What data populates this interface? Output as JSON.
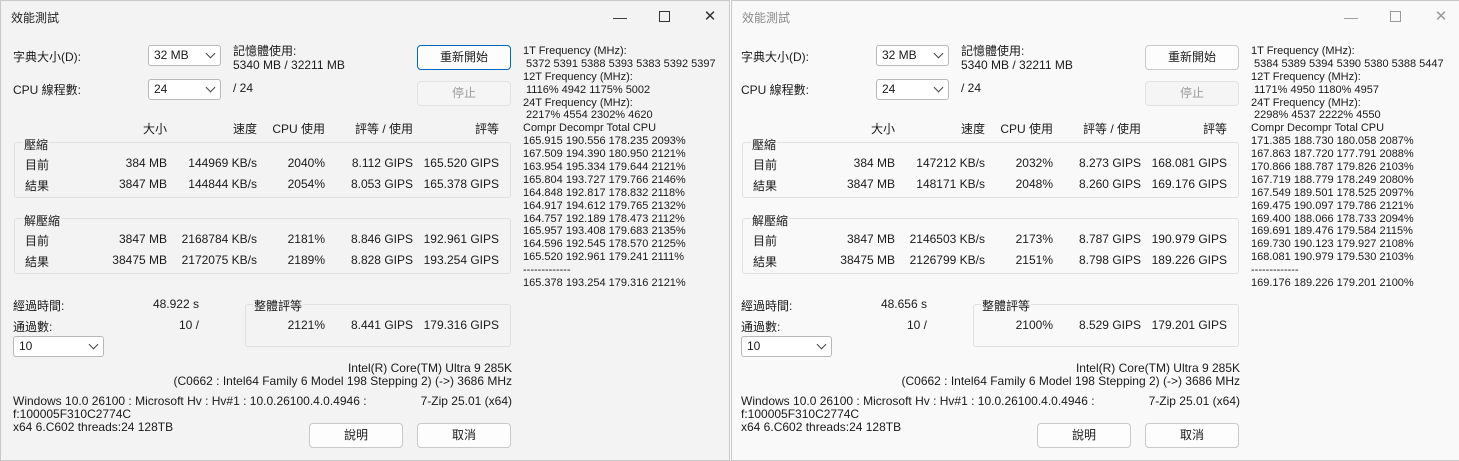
{
  "labels": {
    "dict_size": "字典大小(D):",
    "threads": "CPU 線程數:",
    "mem_usage": "記憶體使用:",
    "restart": "重新開始",
    "stop": "停止",
    "threads_total": "/ 24",
    "col_size": "大小",
    "col_speed": "速度",
    "col_cpu": "CPU 使用",
    "col_rating_usage": "評等 / 使用",
    "col_rating": "評等",
    "compress": "壓縮",
    "decompress": "解壓縮",
    "current": "目前",
    "result": "結果",
    "elapsed": "經過時間:",
    "passes": "通過數:",
    "passes_sep": "10 /",
    "total_rating": "整體評等",
    "help": "說明",
    "cancel": "取消"
  },
  "windows": [
    {
      "title": "效能測試",
      "dict_size": "32 MB",
      "threads": "24",
      "mem_usage": "5340 MB / 32211 MB",
      "compress": {
        "current": {
          "size": "384 MB",
          "speed": "144969 KB/s",
          "cpu": "2040%",
          "rating_usage": "8.112 GIPS",
          "rating": "165.520 GIPS"
        },
        "result": {
          "size": "3847 MB",
          "speed": "144844 KB/s",
          "cpu": "2054%",
          "rating_usage": "8.053 GIPS",
          "rating": "165.378 GIPS"
        }
      },
      "decompress": {
        "current": {
          "size": "3847 MB",
          "speed": "2168784 KB/s",
          "cpu": "2181%",
          "rating_usage": "8.846 GIPS",
          "rating": "192.961 GIPS"
        },
        "result": {
          "size": "38475 MB",
          "speed": "2172075 KB/s",
          "cpu": "2189%",
          "rating_usage": "8.828 GIPS",
          "rating": "193.254 GIPS"
        }
      },
      "elapsed": "48.922 s",
      "passes_select": "10",
      "total": {
        "cpu": "2121%",
        "rating_usage": "8.441 GIPS",
        "rating": "179.316 GIPS"
      },
      "cpu_name": "Intel(R) Core(TM) Ultra 9 285K",
      "cpu_detail": "(C0662 : Intel64 Family 6 Model 198 Stepping 2) (->) 3686 MHz",
      "os_line1": "Windows 10.0 26100 : Microsoft Hv : Hv#1 : 10.0.26100.4.0.4946 :",
      "os_line2": "f:100005F310C2774C",
      "os_line3": "x64 6.C602 threads:24 128TB",
      "version": "7-Zip 25.01 (x64)",
      "freq": [
        "1T Frequency (MHz):",
        " 5372 5391 5388 5393 5383 5392 5397",
        "12T Frequency (MHz):",
        " 1116% 4942 1175% 5002",
        "24T Frequency (MHz):",
        " 2217% 4554 2302% 4620",
        "Compr Decompr Total   CPU",
        "165.915  190.556  178.235  2093%",
        "167.509  194.390  180.950  2121%",
        "163.954  195.334  179.644  2121%",
        "165.804  193.727  179.766  2146%",
        "164.848  192.817  178.832  2118%",
        "164.917  194.612  179.765  2132%",
        "164.757  192.189  178.473  2112%",
        "165.957  193.408  179.683  2135%",
        "164.596  192.545  178.570  2125%",
        "165.520  192.961  179.241  2111%",
        "-------------",
        "165.378  193.254  179.316  2121%"
      ]
    },
    {
      "title": "效能測試",
      "dict_size": "32 MB",
      "threads": "24",
      "mem_usage": "5340 MB / 32211 MB",
      "compress": {
        "current": {
          "size": "384 MB",
          "speed": "147212 KB/s",
          "cpu": "2032%",
          "rating_usage": "8.273 GIPS",
          "rating": "168.081 GIPS"
        },
        "result": {
          "size": "3847 MB",
          "speed": "148171 KB/s",
          "cpu": "2048%",
          "rating_usage": "8.260 GIPS",
          "rating": "169.176 GIPS"
        }
      },
      "decompress": {
        "current": {
          "size": "3847 MB",
          "speed": "2146503 KB/s",
          "cpu": "2173%",
          "rating_usage": "8.787 GIPS",
          "rating": "190.979 GIPS"
        },
        "result": {
          "size": "38475 MB",
          "speed": "2126799 KB/s",
          "cpu": "2151%",
          "rating_usage": "8.798 GIPS",
          "rating": "189.226 GIPS"
        }
      },
      "elapsed": "48.656 s",
      "passes_select": "10",
      "total": {
        "cpu": "2100%",
        "rating_usage": "8.529 GIPS",
        "rating": "179.201 GIPS"
      },
      "cpu_name": "Intel(R) Core(TM) Ultra 9 285K",
      "cpu_detail": "(C0662 : Intel64 Family 6 Model 198 Stepping 2) (->) 3686 MHz",
      "os_line1": "Windows 10.0 26100 : Microsoft Hv : Hv#1 : 10.0.26100.4.0.4946 :",
      "os_line2": "f:100005F310C2774C",
      "os_line3": "x64 6.C602 threads:24 128TB",
      "version": "7-Zip 25.01 (x64)",
      "freq": [
        "1T Frequency (MHz):",
        " 5384 5389 5394 5390 5380 5388 5447",
        "12T Frequency (MHz):",
        " 1171% 4950 1180% 4957",
        "24T Frequency (MHz):",
        " 2298% 4537 2222% 4550",
        "Compr Decompr Total   CPU",
        "171.385  188.730  180.058  2087%",
        "167.863  187.720  177.791  2088%",
        "170.866  188.787  179.826  2103%",
        "167.719  188.779  178.249  2080%",
        "167.549  189.501  178.525  2097%",
        "169.475  190.097  179.786  2121%",
        "169.400  188.066  178.733  2094%",
        "169.691  189.476  179.584  2115%",
        "169.730  190.123  179.927  2108%",
        "168.081  190.979  179.530  2103%",
        "-------------",
        "169.176  189.226  179.201  2100%"
      ]
    }
  ]
}
